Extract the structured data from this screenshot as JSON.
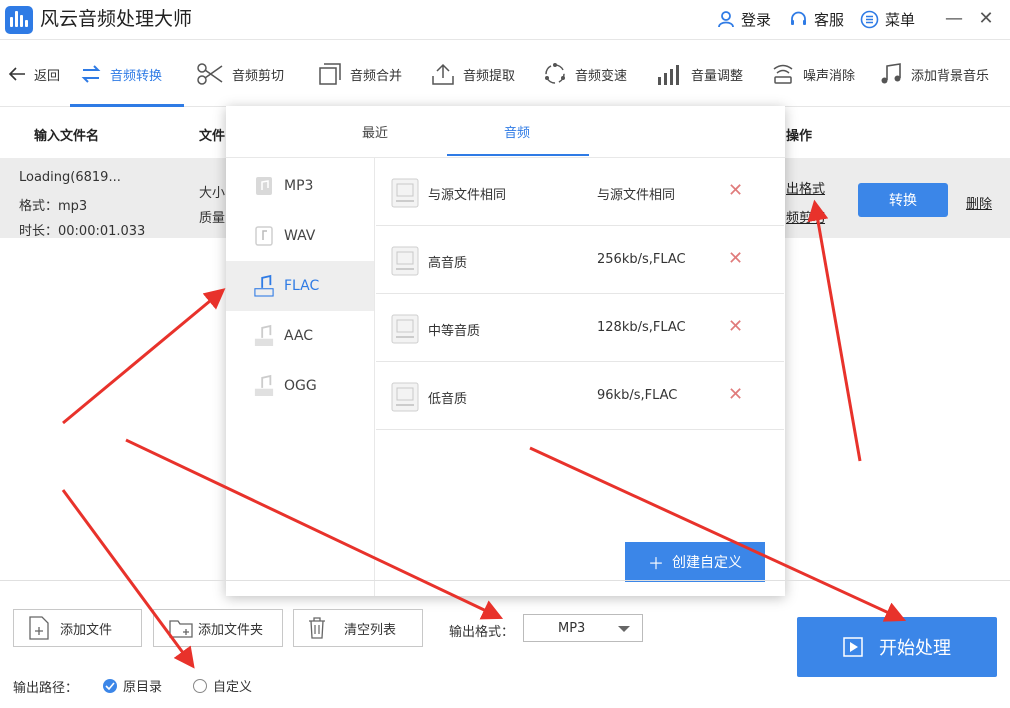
{
  "app": {
    "title": "风云音频处理大师",
    "login": "登录",
    "service": "客服",
    "menu": "菜单",
    "minimize": "—",
    "close": "✕"
  },
  "toolbar": {
    "back": "返回",
    "items": [
      "音频转换",
      "音频剪切",
      "音频合并",
      "音频提取",
      "音频变速",
      "音量调整",
      "噪声消除",
      "添加背景音乐"
    ]
  },
  "table": {
    "headers": {
      "input": "输入文件名",
      "file": "文件",
      "action": "操作"
    },
    "row": {
      "name": "Loading(6819...",
      "format": "格式：mp3",
      "duration": "时长：00:00:01.033",
      "size": "大小",
      "quality": "质量",
      "output_format_link": "出格式",
      "audio_cut_link": "频剪切",
      "convert": "转换",
      "delete": "删除"
    }
  },
  "popup": {
    "tabs": [
      "最近",
      "音频"
    ],
    "formats": [
      "MP3",
      "WAV",
      "FLAC",
      "AAC",
      "OGG"
    ],
    "selected_format": "FLAC",
    "presets": [
      {
        "name": "与源文件相同",
        "value": "与源文件相同"
      },
      {
        "name": "高音质",
        "value": "256kb/s,FLAC"
      },
      {
        "name": "中等音质",
        "value": "128kb/s,FLAC"
      },
      {
        "name": "低音质",
        "value": "96kb/s,FLAC"
      }
    ],
    "delete_glyph": "✕",
    "create_custom": "创建自定义",
    "create_plus": "＋"
  },
  "bottom": {
    "add_file": "添加文件",
    "add_folder": "添加文件夹",
    "clear_list": "清空列表",
    "output_format_label": "输出格式：",
    "output_format_value": "MP3",
    "output_path_label": "输出路径：",
    "radio_original": "原目录",
    "radio_custom": "自定义",
    "radio_selected": "原目录",
    "start": "开始处理"
  },
  "colors": {
    "accent": "#2f7be5",
    "button": "#3b86e8",
    "arrow": "#e8322b",
    "delete_x": "#e07b7b"
  },
  "icons": {
    "logo": "waveform-logo-icon",
    "user": "user-icon",
    "headset": "headset-icon",
    "menu": "menu-list-icon",
    "back": "arrow-left-icon",
    "sound_file": "sound-file-icon"
  }
}
